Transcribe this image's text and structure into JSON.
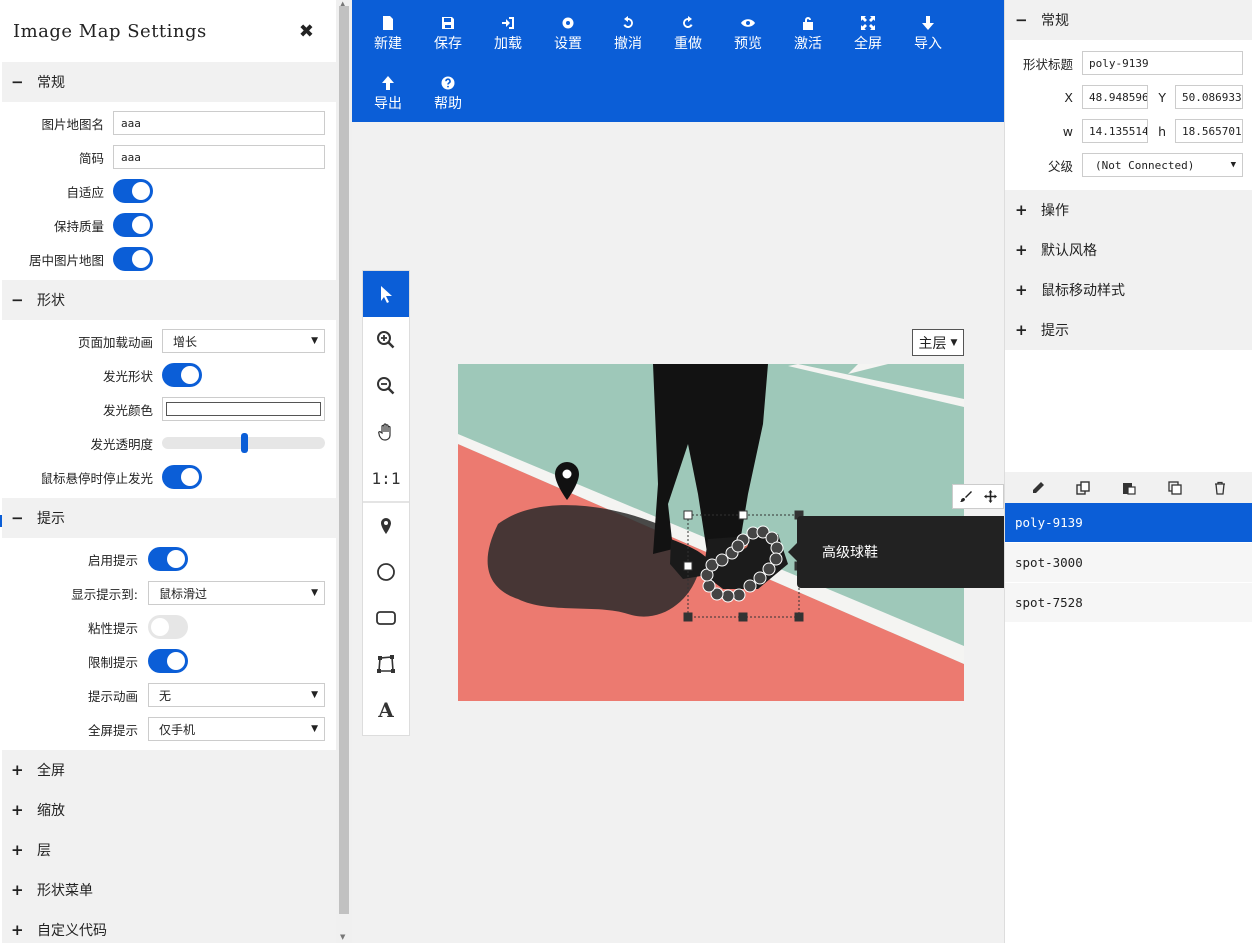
{
  "left_panel": {
    "title": "Image Map Settings",
    "close_glyph": "✖",
    "general": {
      "title": "常规",
      "symbol": "−",
      "name_label": "图片地图名",
      "name_value": "aaa",
      "shortcode_label": "简码",
      "shortcode_value": "aaa",
      "responsive_label": "自适应",
      "responsive": true,
      "quality_label": "保持质量",
      "quality": true,
      "center_label": "居中图片地图",
      "center": true
    },
    "shapes": {
      "title": "形状",
      "symbol": "−",
      "anim_label": "页面加载动画",
      "anim_value": "增长",
      "glow_label": "发光形状",
      "glow": true,
      "glow_color_label": "发光颜色",
      "glow_color": "#ffffff",
      "glow_opacity_label": "发光透明度",
      "glow_opacity": 0.5,
      "stop_glow_label": "鼠标悬停时停止发光",
      "stop_glow": true
    },
    "tooltips": {
      "title": "提示",
      "symbol": "−",
      "enable_label": "启用提示",
      "enable": true,
      "show_on_label": "显示提示到:",
      "show_on_value": "鼠标滑过",
      "sticky_label": "粘性提示",
      "sticky": false,
      "constrain_label": "限制提示",
      "constrain": true,
      "anim_label": "提示动画",
      "anim_value": "无",
      "fullscreen_label": "全屏提示",
      "fullscreen_value": "仅手机"
    },
    "collapsed_sections": [
      {
        "symbol": "+",
        "title": "全屏"
      },
      {
        "symbol": "+",
        "title": "缩放"
      },
      {
        "symbol": "+",
        "title": "层"
      },
      {
        "symbol": "+",
        "title": "形状菜单"
      },
      {
        "symbol": "+",
        "title": "自定义代码"
      }
    ]
  },
  "toolbar": {
    "buttons": [
      {
        "label": "新建",
        "icon": "file-icon"
      },
      {
        "label": "保存",
        "icon": "save-icon"
      },
      {
        "label": "加载",
        "icon": "sign-in-icon"
      },
      {
        "label": "设置",
        "icon": "gear-icon"
      },
      {
        "label": "撤消",
        "icon": "undo-icon"
      },
      {
        "label": "重做",
        "icon": "redo-icon"
      },
      {
        "label": "预览",
        "icon": "eye-icon"
      },
      {
        "label": "激活",
        "icon": "unlock-icon"
      },
      {
        "label": "全屏",
        "icon": "expand-icon"
      },
      {
        "label": "导入",
        "icon": "arrow-down-icon"
      },
      {
        "label": "导出",
        "icon": "arrow-up-icon"
      },
      {
        "label": "帮助",
        "icon": "question-icon"
      }
    ]
  },
  "canvas": {
    "tools": [
      "pointer-icon",
      "zoom-in-icon",
      "zoom-out-icon",
      "hand-icon",
      "one-to-one",
      "spot-icon",
      "circle-icon",
      "rect-icon",
      "poly-icon",
      "text-icon"
    ],
    "one_to_one_label": "1:1",
    "text_tool_glyph": "A",
    "layer_select": "主层",
    "tooltip_text": "高级球鞋"
  },
  "right_panel": {
    "general": {
      "title": "常规",
      "symbol": "−",
      "shape_title_label": "形状标题",
      "shape_title_value": "poly-9139",
      "x_label": "X",
      "x_value": "48.948596",
      "y_label": "Y",
      "y_value": "50.086933",
      "w_label": "w",
      "w_value": "14.135514",
      "h_label": "h",
      "h_value": "18.565701",
      "parent_label": "父级",
      "parent_value": "(Not Connected)"
    },
    "collapsed_sections": [
      {
        "symbol": "+",
        "title": "操作"
      },
      {
        "symbol": "+",
        "title": "默认风格"
      },
      {
        "symbol": "+",
        "title": "鼠标移动样式"
      },
      {
        "symbol": "+",
        "title": "提示"
      }
    ],
    "shape_list": [
      "poly-9139",
      "spot-3000",
      "spot-7528"
    ],
    "selected_shape": "poly-9139"
  },
  "colors": {
    "accent": "#0b5ed7",
    "court_red": "#ec7a70",
    "court_green": "#9ec8b9"
  }
}
